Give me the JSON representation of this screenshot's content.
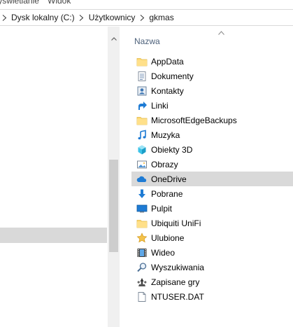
{
  "ribbon": {
    "tabs": [
      "Wyświetlanie",
      "Widok"
    ]
  },
  "address_bar": {
    "crumbs": [
      "Dysk lokalny (C:)",
      "Użytkownicy",
      "gkmas"
    ]
  },
  "content": {
    "column_header": "Nazwa",
    "sort": "ascending",
    "files": [
      {
        "name": "AppData",
        "icon": "folder-icon"
      },
      {
        "name": "Dokumenty",
        "icon": "documents-icon"
      },
      {
        "name": "Kontakty",
        "icon": "contacts-icon"
      },
      {
        "name": "Linki",
        "icon": "links-icon"
      },
      {
        "name": "MicrosoftEdgeBackups",
        "icon": "folder-icon"
      },
      {
        "name": "Muzyka",
        "icon": "music-icon"
      },
      {
        "name": "Obiekty 3D",
        "icon": "3d-objects-icon"
      },
      {
        "name": "Obrazy",
        "icon": "pictures-icon"
      },
      {
        "name": "OneDrive",
        "icon": "onedrive-icon",
        "selected": true
      },
      {
        "name": "Pobrane",
        "icon": "downloads-icon"
      },
      {
        "name": "Pulpit",
        "icon": "desktop-icon"
      },
      {
        "name": "Ubiquiti UniFi",
        "icon": "folder-icon"
      },
      {
        "name": "Ulubione",
        "icon": "favorites-icon"
      },
      {
        "name": "Wideo",
        "icon": "videos-icon"
      },
      {
        "name": "Wyszukiwania",
        "icon": "searches-icon"
      },
      {
        "name": "Zapisane gry",
        "icon": "saved-games-icon"
      },
      {
        "name": "NTUSER.DAT",
        "icon": "file-icon"
      }
    ]
  },
  "colors": {
    "selection": "#d9d9d9",
    "folder": "#ffe08a",
    "accent_blue": "#1e7bd4",
    "header_text": "#4c607a"
  }
}
